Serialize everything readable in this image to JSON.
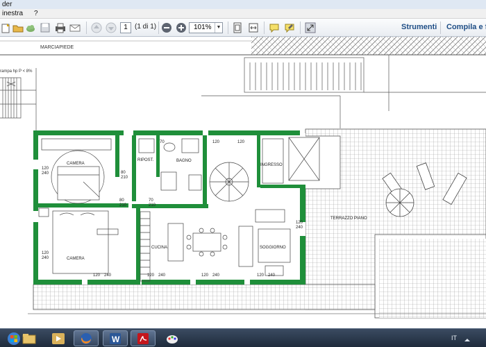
{
  "window": {
    "title_fragment": "der"
  },
  "menu": {
    "items": [
      "inestra",
      "?"
    ]
  },
  "toolbar": {
    "page_value": "1",
    "page_of": "(1 di 1)",
    "zoom": "101%",
    "tools_label": "Strumenti",
    "sign_label": "Compila e fir"
  },
  "plan": {
    "street": "MARCIAPIEDE",
    "ramp": "rampa hp P < 8%",
    "rooms": {
      "camera_top": "CAMERA",
      "ripost": "RIPOST.",
      "bagno": "BAGNO",
      "ingresso": "INGRESSO",
      "camera_bottom": "CAMERA",
      "cucina": "CUCINA",
      "soggiorno": "SOGGIORNO",
      "terrazzo": "TERRAZZO PIANO"
    },
    "dims": {
      "d120_240": [
        "120",
        "240"
      ],
      "d120_210": [
        "120",
        "210"
      ],
      "d80_210": [
        "80",
        "210"
      ],
      "d70_210": [
        "70",
        "210"
      ]
    }
  },
  "taskbar": {
    "lang": "IT",
    "apps": [
      "windows-start",
      "explorer",
      "media-player",
      "file-folder",
      "firefox",
      "word",
      "acrobat",
      "paint"
    ]
  },
  "colors": {
    "wall": "#1f8f3a",
    "link": "#1f4e86",
    "taskbar": "#2a3a50"
  }
}
